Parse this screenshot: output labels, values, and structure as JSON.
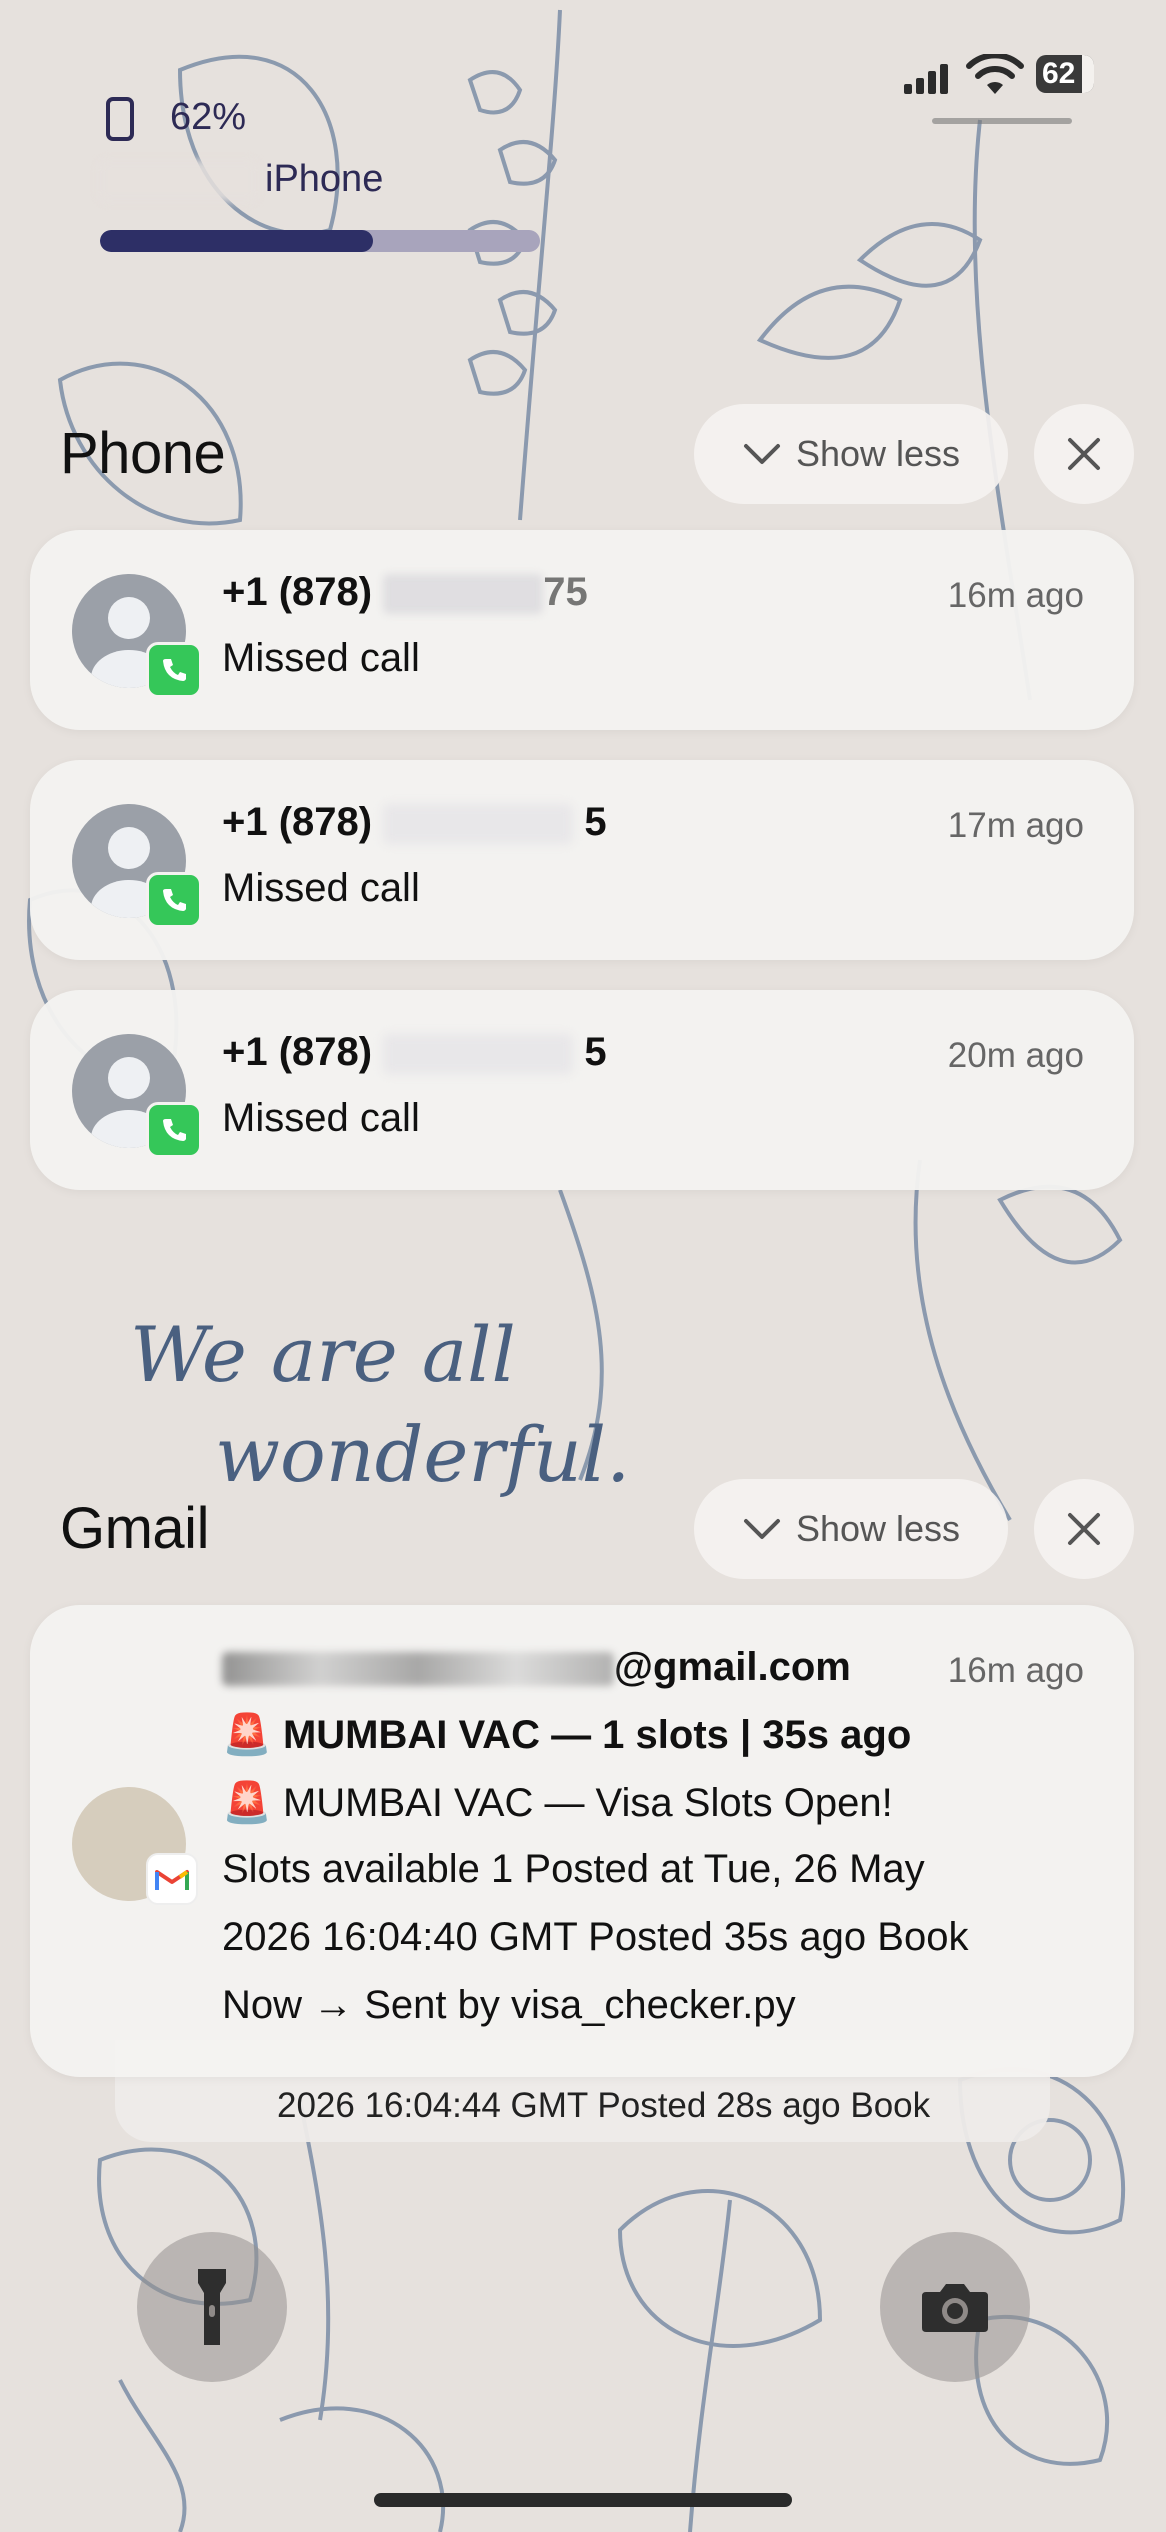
{
  "status_bar": {
    "battery_level": "62"
  },
  "battery_widget": {
    "percent": "62%",
    "device_name": "iPhone",
    "charge_fraction": 0.62
  },
  "wallpaper": {
    "quote_line1": "We are all",
    "quote_line2": "wonderful."
  },
  "phone_group": {
    "app_name": "Phone",
    "show_less_label": "Show less",
    "notifications": [
      {
        "number_visible": "+1 (878)",
        "number_tail": "75",
        "body": "Missed call",
        "time": "16m ago"
      },
      {
        "number_visible": "+1 (878)",
        "number_tail": "5",
        "body": "Missed call",
        "time": "17m ago"
      },
      {
        "number_visible": "+1 (878)",
        "number_tail": "5",
        "body": "Missed call",
        "time": "20m ago"
      }
    ]
  },
  "gmail_group": {
    "app_name": "Gmail",
    "show_less_label": "Show less",
    "notification": {
      "sender_suffix": "@gmail.com",
      "time": "16m ago",
      "subject_emoji": "🚨",
      "subject": "MUMBAI VAC — 1 slots | 35s ago",
      "line1_emoji": "🚨",
      "line1": "MUMBAI VAC — Visa Slots Open!",
      "line2": "Slots available 1 Posted at Tue, 26 May",
      "line3": "2026 16:04:40 GMT Posted 35s ago Book",
      "line4": "Now → Sent by visa_checker.py"
    },
    "stacked_preview": "2026 16:04:44 GMT Posted 28s ago Book"
  },
  "colors": {
    "phone_green": "#35c759",
    "widget_navy": "#2d2f66",
    "ink_blue": "#4a6080"
  }
}
